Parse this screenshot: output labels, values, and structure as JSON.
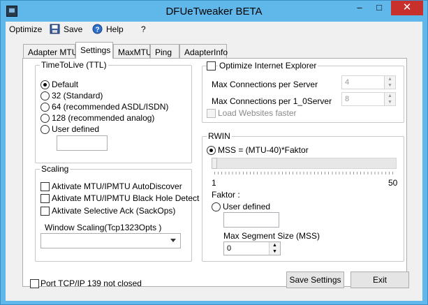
{
  "window": {
    "title": "DFUeTweaker BETA",
    "minimize": "–",
    "maximize": "□",
    "close": "✕"
  },
  "menu": {
    "optimize": "Optimize",
    "save": "Save",
    "help": "Help",
    "about": "?"
  },
  "tabs": [
    {
      "label": "Adapter MTU"
    },
    {
      "label": "Settings"
    },
    {
      "label": "MaxMTU"
    },
    {
      "label": "Ping"
    },
    {
      "label": "AdapterInfo"
    }
  ],
  "ttl": {
    "title": "TimeToLive (TTL)",
    "options": [
      "Default",
      "32 (Standard)",
      "64 (recommended ASDL/ISDN)",
      "128 (recommended analog)",
      "User defined"
    ],
    "user_value": ""
  },
  "ie": {
    "label": "Optimize Internet Explorer",
    "max_conn_server_label": "Max Connections per Server",
    "max_conn_server_value": "4",
    "max_conn_10_label": "Max Connections per 1_0Server",
    "max_conn_10_value": "8",
    "load_websites_label": "Load Websites faster"
  },
  "scaling": {
    "title": "Scaling",
    "autodiscover": "Aktivate MTU/IPMTU AutoDiscover",
    "blackhole": "Aktivate MTU/IPMTU Black Hole Detect",
    "sackops": "Aktivate Selective Ack (SackOps)",
    "window_scaling_label": "Window Scaling(Tcp1323Opts )",
    "window_scaling_value": ""
  },
  "rwin": {
    "title": "RWIN",
    "mss_label": "MSS  = (MTU-40)*Faktor",
    "slider_min": "1",
    "slider_max": "50",
    "slider_value": 1,
    "faktor_label": "Faktor :",
    "user_defined_label": "User defined",
    "user_value": "",
    "max_segment_label": "Max Segment Size (MSS)",
    "max_segment_value": "0"
  },
  "footer": {
    "port_label": "Port TCP/IP 139 not closed",
    "save_settings": "Save Settings",
    "exit": "Exit"
  }
}
